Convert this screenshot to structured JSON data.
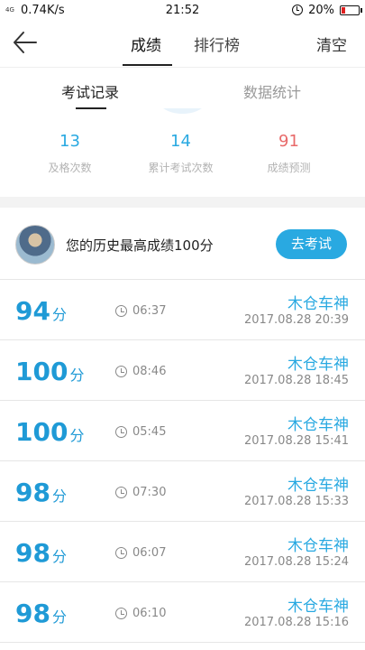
{
  "status_bar": {
    "signal": "4G",
    "speed": "0.74K/s",
    "time": "21:52",
    "battery": "20%",
    "battery_level": 0.2
  },
  "nav": {
    "tabs": [
      {
        "label": "成绩"
      },
      {
        "label": "排行榜"
      }
    ],
    "clear_label": "清空"
  },
  "sub_tabs": [
    {
      "label": "考试记录"
    },
    {
      "label": "数据统计"
    }
  ],
  "stats": [
    {
      "value": "13",
      "label": "及格次数"
    },
    {
      "value": "14",
      "label": "累计考试次数"
    },
    {
      "value": "91",
      "label": "成绩预测"
    }
  ],
  "best": {
    "text": "您的历史最高成绩100分",
    "button_label": "去考试"
  },
  "records": [
    {
      "score": "94",
      "unit": "分",
      "duration": "06:37",
      "name": "木仓车神",
      "time": "2017.08.28  20:39"
    },
    {
      "score": "100",
      "unit": "分",
      "duration": "08:46",
      "name": "木仓车神",
      "time": "2017.08.28  18:45"
    },
    {
      "score": "100",
      "unit": "分",
      "duration": "05:45",
      "name": "木仓车神",
      "time": "2017.08.28  15:41"
    },
    {
      "score": "98",
      "unit": "分",
      "duration": "07:30",
      "name": "木仓车神",
      "time": "2017.08.28  15:33"
    },
    {
      "score": "98",
      "unit": "分",
      "duration": "06:07",
      "name": "木仓车神",
      "time": "2017.08.28  15:24"
    },
    {
      "score": "98",
      "unit": "分",
      "duration": "06:10",
      "name": "木仓车神",
      "time": "2017.08.28  15:16"
    }
  ],
  "colors": {
    "accent": "#29a9e1",
    "score": "#1f9ad6",
    "prediction": "#e86a6a"
  }
}
